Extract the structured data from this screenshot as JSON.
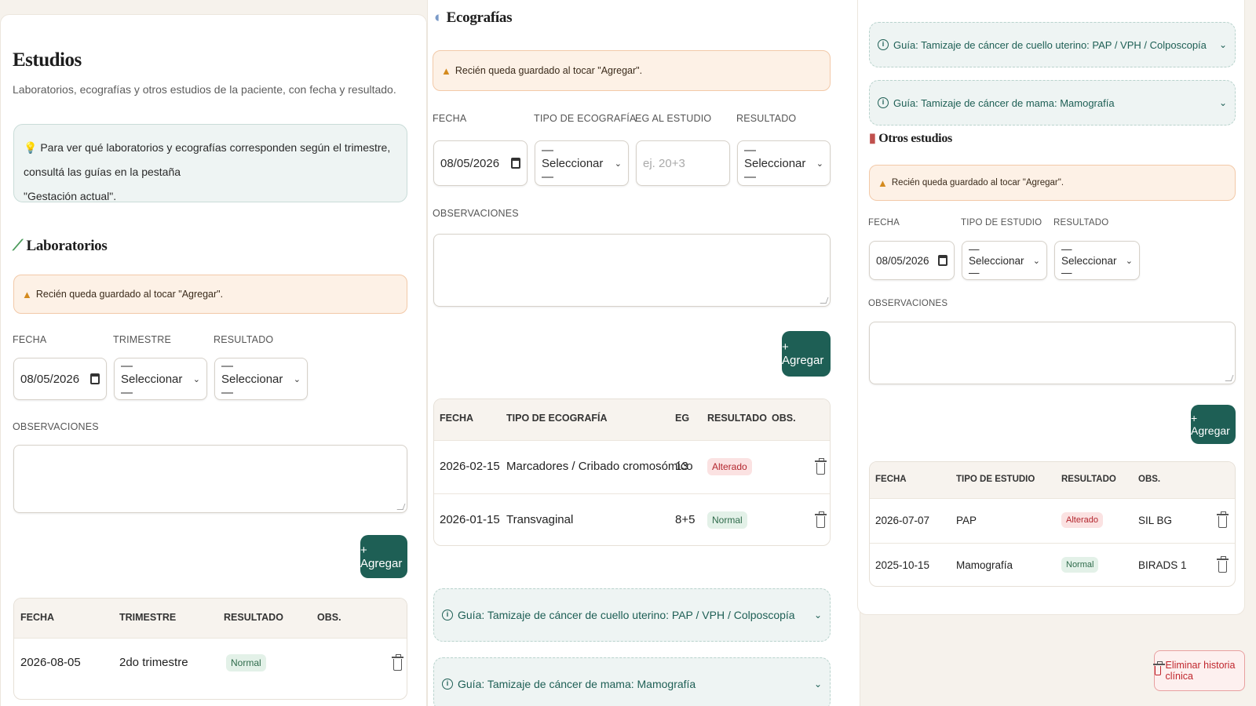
{
  "estudios": {
    "title": "Estudios",
    "subtitle": "Laboratorios, ecografías y otros estudios de la paciente, con fecha y resultado.",
    "info_line1": "Para ver qué laboratorios y ecografías corresponden según el trimestre, consultá las guías en la pestaña",
    "info_line2": "\"Gestación actual\"."
  },
  "warning_text": "Recién queda guardado al tocar \"Agregar\".",
  "add_label": "+ Agregar",
  "select_placeholder": "— Seleccionar —",
  "obs_label": "OBSERVACIONES",
  "date_value": "08/05/2026",
  "laboratorios": {
    "title": "Laboratorios",
    "fields": {
      "fecha": "FECHA",
      "trimestre": "TRIMESTRE",
      "resultado": "RESULTADO"
    },
    "table": {
      "headers": [
        "FECHA",
        "TRIMESTRE",
        "RESULTADO",
        "OBS."
      ],
      "rows": [
        {
          "fecha": "2026-08-05",
          "trimestre": "2do trimestre",
          "resultado": "Normal",
          "obs": ""
        }
      ]
    }
  },
  "ecografias": {
    "title": "Ecografías",
    "fields": {
      "fecha": "FECHA",
      "tipo": "TIPO DE ECOGRAFÍA",
      "eg": "EG AL ESTUDIO",
      "resultado": "RESULTADO"
    },
    "eg_placeholder": "ej. 20+3",
    "table": {
      "headers": [
        "FECHA",
        "TIPO DE ECOGRAFÍA",
        "EG",
        "RESULTADO",
        "OBS."
      ],
      "rows": [
        {
          "fecha": "2026-02-15",
          "tipo": "Marcadores / Cribado cromosómico",
          "eg": "13",
          "resultado": "Alterado",
          "obs": ""
        },
        {
          "fecha": "2026-01-15",
          "tipo": "Transvaginal",
          "eg": "8+5",
          "resultado": "Normal",
          "obs": ""
        }
      ]
    }
  },
  "guides": {
    "cervix": "Guía: Tamizaje de cáncer de cuello uterino: PAP / VPH / Colposcopía",
    "mama": "Guía: Tamizaje de cáncer de mama: Mamografía"
  },
  "otros": {
    "title": "Otros estudios",
    "fields": {
      "fecha": "FECHA",
      "tipo": "TIPO DE ESTUDIO",
      "resultado": "RESULTADO"
    },
    "table": {
      "headers": [
        "FECHA",
        "TIPO DE ESTUDIO",
        "RESULTADO",
        "OBS."
      ],
      "rows": [
        {
          "fecha": "2026-07-07",
          "tipo": "PAP",
          "resultado": "Alterado",
          "obs": "SIL BG"
        },
        {
          "fecha": "2025-10-15",
          "tipo": "Mamografía",
          "resultado": "Normal",
          "obs": "BIRADS 1"
        }
      ]
    }
  },
  "delete_history_label": "Eliminar historia clínica",
  "colors": {
    "accent": "#1e5f55",
    "warning_bg": "#fdf1e6",
    "danger": "#c0262d"
  }
}
